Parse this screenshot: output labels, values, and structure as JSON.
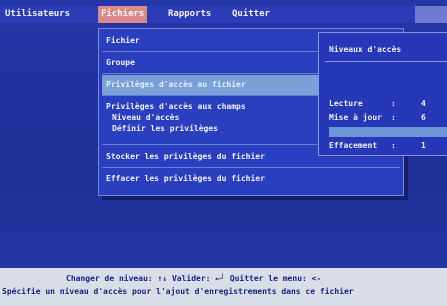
{
  "menubar": {
    "items": [
      {
        "label": "Utilisateurs"
      },
      {
        "label": "Fichiers"
      },
      {
        "label": "Rapports"
      },
      {
        "label": "Quitter"
      }
    ]
  },
  "files_menu": {
    "items": [
      {
        "label": "Fichier"
      },
      {
        "label": "Groupe"
      },
      {
        "label": "Privilèges d'accès au fichier"
      },
      {
        "label": "Privilèges d'accès aux champs"
      },
      {
        "label": "Stocker les privilèges du fichier"
      },
      {
        "label": "Effacer les privilèges du fichier"
      }
    ],
    "field_subitems": [
      {
        "label": "Niveau d'accès"
      },
      {
        "label": "Définir les privilèges"
      }
    ]
  },
  "access_panel": {
    "title": "Niveaux d'accès",
    "rows": [
      {
        "label": "Lecture",
        "sep": ":",
        "value": "4"
      },
      {
        "label": "Mise à jour",
        "sep": ":",
        "value": "6"
      },
      {
        "label": "",
        "sep": "",
        "value": ""
      },
      {
        "label": "Effacement",
        "sep": ":",
        "value": "1"
      }
    ]
  },
  "status": {
    "keys": "Changer de niveau: ↑↓   Valider: ←┘   Quitter le menu: <-",
    "description": "Spécifie un niveau d'accès pour l'ajout d'enregistrements dans ce fichier"
  },
  "colors": {
    "background": "#1e2a8f",
    "menu_selected": "#d98a8a",
    "item_highlight": "#7aa0d8",
    "status_bar": "#d9dde8"
  }
}
